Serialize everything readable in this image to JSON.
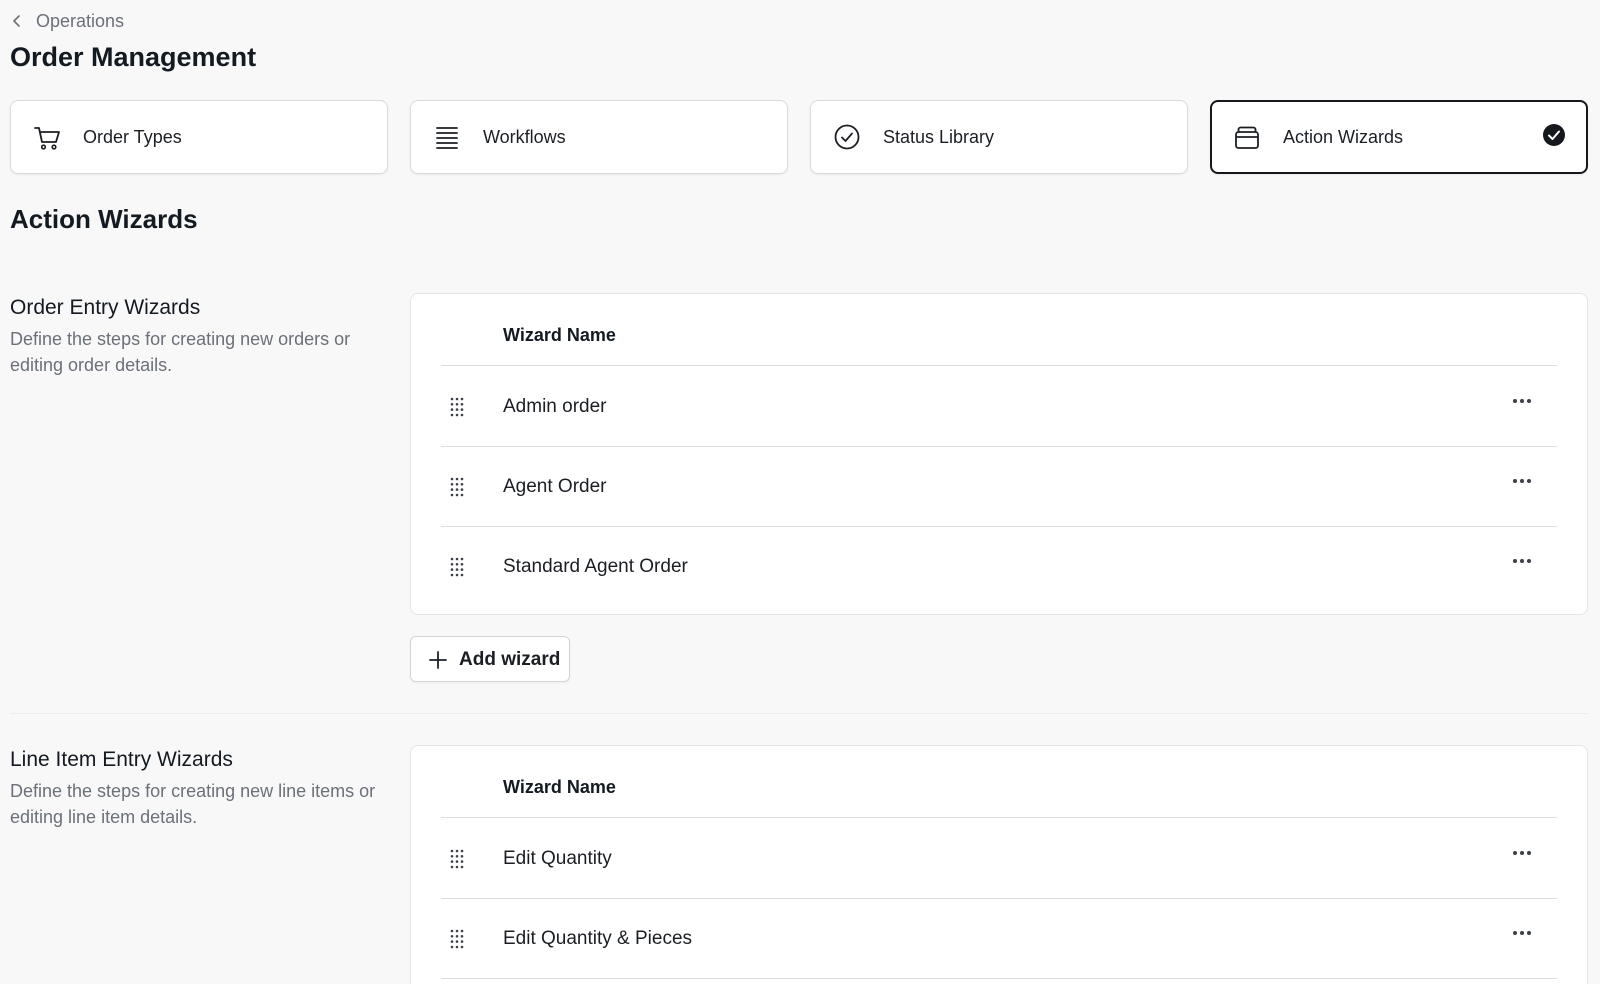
{
  "breadcrumb": {
    "label": "Operations"
  },
  "page_title": "Order Management",
  "tabs": [
    {
      "label": "Order Types",
      "icon": "cart-icon",
      "active": false
    },
    {
      "label": "Workflows",
      "icon": "list-lines-icon",
      "active": false
    },
    {
      "label": "Status Library",
      "icon": "check-circle-icon",
      "active": false
    },
    {
      "label": "Action Wizards",
      "icon": "stack-card-icon",
      "active": true
    }
  ],
  "section_title": "Action Wizards",
  "groups": [
    {
      "title": "Order Entry Wizards",
      "description": "Define the steps for creating new orders or editing order details.",
      "column_header": "Wizard Name",
      "rows": [
        "Admin order",
        "Agent Order",
        "Standard Agent Order"
      ],
      "add_label": "Add wizard"
    },
    {
      "title": "Line Item Entry Wizards",
      "description": "Define the steps for creating new line items or editing line item details.",
      "column_header": "Wizard Name",
      "rows": [
        "Edit Quantity",
        "Edit Quantity & Pieces"
      ]
    }
  ],
  "colors": {
    "background": "#f8f8f8",
    "text": "#141a21",
    "muted": "#6b7079",
    "border": "#dcdee2",
    "active_border": "#15191e"
  }
}
